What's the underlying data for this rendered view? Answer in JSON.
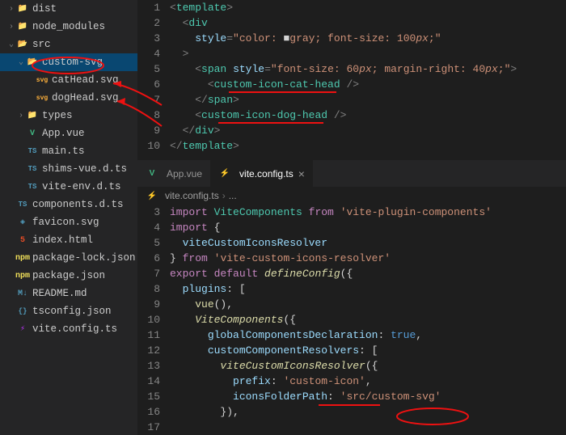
{
  "sidebar": {
    "items": [
      {
        "t": "dist",
        "chev": "›",
        "icon": "📁",
        "ic": "folder",
        "lvl": 0
      },
      {
        "t": "node_modules",
        "chev": "›",
        "icon": "📁",
        "ic": "folder",
        "lvl": 0
      },
      {
        "t": "src",
        "chev": "⌄",
        "icon": "📂",
        "ic": "folder",
        "lvl": 0
      },
      {
        "t": "custom-svg",
        "chev": "⌄",
        "icon": "📂",
        "ic": "folder",
        "lvl": 1,
        "sel": true
      },
      {
        "t": "catHead.svg",
        "icon": "svg",
        "ic": "svg",
        "lvl": 2
      },
      {
        "t": "dogHead.svg",
        "icon": "svg",
        "ic": "svg",
        "lvl": 2
      },
      {
        "t": "types",
        "chev": "›",
        "icon": "📁",
        "ic": "folder",
        "lvl": 1
      },
      {
        "t": "App.vue",
        "icon": "V",
        "ic": "vue",
        "lvl": 1
      },
      {
        "t": "main.ts",
        "icon": "TS",
        "ic": "ts",
        "lvl": 1
      },
      {
        "t": "shims-vue.d.ts",
        "icon": "TS",
        "ic": "ts",
        "lvl": 1
      },
      {
        "t": "vite-env.d.ts",
        "icon": "TS",
        "ic": "ts",
        "lvl": 1
      },
      {
        "t": "components.d.ts",
        "icon": "TS",
        "ic": "ts",
        "lvl": 0
      },
      {
        "t": "favicon.svg",
        "icon": "◈",
        "ic": "ico",
        "lvl": 0
      },
      {
        "t": "index.html",
        "icon": "5",
        "ic": "html",
        "lvl": 0
      },
      {
        "t": "package-lock.json",
        "icon": "npm",
        "ic": "json",
        "lvl": 0
      },
      {
        "t": "package.json",
        "icon": "npm",
        "ic": "json",
        "lvl": 0
      },
      {
        "t": "README.md",
        "icon": "M↓",
        "ic": "md",
        "lvl": 0
      },
      {
        "t": "tsconfig.json",
        "icon": "{}",
        "ic": "ts",
        "lvl": 0
      },
      {
        "t": "vite.config.ts",
        "icon": "⚡",
        "ic": "vite",
        "lvl": 0
      }
    ]
  },
  "pane1": {
    "lines": [
      "1",
      "2",
      "3",
      "4",
      "5",
      "6",
      "7",
      "8",
      "9",
      "10"
    ],
    "code": [
      [
        [
          "pun",
          "<"
        ],
        [
          "tag",
          "template"
        ],
        [
          "pun",
          ">"
        ]
      ],
      [
        [
          "txt",
          "  "
        ],
        [
          "pun",
          "<"
        ],
        [
          "tag",
          "div"
        ]
      ],
      [
        [
          "txt",
          "    "
        ],
        [
          "attr",
          "style"
        ],
        [
          "pun",
          "="
        ],
        [
          "val",
          "\"color: "
        ],
        [
          "txt",
          "■"
        ],
        [
          "val",
          "gray; font-size: 100"
        ],
        [
          "px",
          "px"
        ],
        [
          "val",
          ";\""
        ]
      ],
      [
        [
          "txt",
          "  "
        ],
        [
          "pun",
          ">"
        ]
      ],
      [
        [
          "txt",
          "    "
        ],
        [
          "pun",
          "<"
        ],
        [
          "tag",
          "span"
        ],
        [
          "txt",
          " "
        ],
        [
          "attr",
          "style"
        ],
        [
          "pun",
          "="
        ],
        [
          "val",
          "\"font-size: 60"
        ],
        [
          "px",
          "px"
        ],
        [
          "val",
          "; margin-right: 40"
        ],
        [
          "px",
          "px"
        ],
        [
          "val",
          ";\""
        ],
        [
          "pun",
          ">"
        ]
      ],
      [
        [
          "txt",
          "      "
        ],
        [
          "pun",
          "<"
        ],
        [
          "tag",
          "custom-icon-cat-head"
        ],
        [
          "txt",
          " "
        ],
        [
          "pun",
          "/>"
        ]
      ],
      [
        [
          "txt",
          "    "
        ],
        [
          "pun",
          "</"
        ],
        [
          "tag",
          "span"
        ],
        [
          "pun",
          ">"
        ]
      ],
      [
        [
          "txt",
          "    "
        ],
        [
          "pun",
          "<"
        ],
        [
          "tag",
          "custom-icon-dog-head"
        ],
        [
          "txt",
          " "
        ],
        [
          "pun",
          "/>"
        ]
      ],
      [
        [
          "txt",
          "  "
        ],
        [
          "pun",
          "</"
        ],
        [
          "tag",
          "div"
        ],
        [
          "pun",
          ">"
        ]
      ],
      [
        [
          "pun",
          "</"
        ],
        [
          "tag",
          "template"
        ],
        [
          "pun",
          ">"
        ]
      ]
    ]
  },
  "tabs": [
    {
      "label": "App.vue",
      "icon": "V",
      "ic": "vue",
      "active": false
    },
    {
      "label": "vite.config.ts",
      "icon": "⚡",
      "ic": "vite",
      "active": true
    }
  ],
  "breadcrumb": {
    "icon": "⚡",
    "file": "vite.config.ts",
    "sep": "›",
    "rest": "..."
  },
  "pane2": {
    "lines": [
      "3",
      "4",
      "5",
      "6",
      "7",
      "8",
      "9",
      "10",
      "11",
      "12",
      "13",
      "14",
      "15",
      "16",
      "17"
    ],
    "code": [
      [
        [
          "kw",
          "import"
        ],
        [
          "txt",
          " "
        ],
        [
          "cls",
          "ViteComponents"
        ],
        [
          "txt",
          " "
        ],
        [
          "kw",
          "from"
        ],
        [
          "txt",
          " "
        ],
        [
          "val",
          "'vite-plugin-components'"
        ]
      ],
      [
        [
          "kw",
          "import"
        ],
        [
          "txt",
          " {"
        ]
      ],
      [
        [
          "txt",
          "  "
        ],
        [
          "prop",
          "viteCustomIconsResolver"
        ]
      ],
      [
        [
          "txt",
          "} "
        ],
        [
          "kw",
          "from"
        ],
        [
          "txt",
          " "
        ],
        [
          "val",
          "'vite-custom-icons-resolver'"
        ]
      ],
      [
        [
          "txt",
          ""
        ]
      ],
      [
        [
          "kw",
          "export"
        ],
        [
          "txt",
          " "
        ],
        [
          "kw",
          "default"
        ],
        [
          "txt",
          " "
        ],
        [
          "fn it",
          "defineConfig"
        ],
        [
          "txt",
          "({"
        ]
      ],
      [
        [
          "txt",
          "  "
        ],
        [
          "prop",
          "plugins"
        ],
        [
          "txt",
          ": ["
        ]
      ],
      [
        [
          "txt",
          "    "
        ],
        [
          "fn",
          "vue"
        ],
        [
          "txt",
          "(),"
        ]
      ],
      [
        [
          "txt",
          "    "
        ],
        [
          "fn it",
          "ViteComponents"
        ],
        [
          "txt",
          "({"
        ]
      ],
      [
        [
          "txt",
          "      "
        ],
        [
          "prop",
          "globalComponentsDeclaration"
        ],
        [
          "txt",
          ": "
        ],
        [
          "bool",
          "true"
        ],
        [
          "txt",
          ","
        ]
      ],
      [
        [
          "txt",
          "      "
        ],
        [
          "prop",
          "customComponentResolvers"
        ],
        [
          "txt",
          ": ["
        ]
      ],
      [
        [
          "txt",
          "        "
        ],
        [
          "fn it",
          "viteCustomIconsResolver"
        ],
        [
          "txt",
          "({"
        ]
      ],
      [
        [
          "txt",
          "          "
        ],
        [
          "prop",
          "prefix"
        ],
        [
          "txt",
          ": "
        ],
        [
          "val",
          "'custom-icon'"
        ],
        [
          "txt",
          ","
        ]
      ],
      [
        [
          "txt",
          "          "
        ],
        [
          "prop",
          "iconsFolderPath"
        ],
        [
          "txt",
          ": "
        ],
        [
          "val",
          "'src/custom-svg'"
        ]
      ],
      [
        [
          "txt",
          "        }),"
        ]
      ]
    ]
  },
  "chart_data": null
}
